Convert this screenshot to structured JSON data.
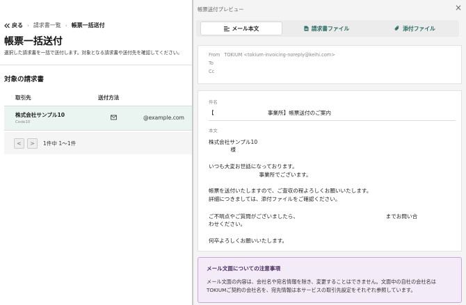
{
  "breadcrumb": {
    "back": "戻る",
    "list": "請求書一覧",
    "current": "帳票一括送付"
  },
  "page": {
    "title": "帳票一括送付",
    "description": "選択した請求書を一括で送付します。対象となる請求書や送付先を確認してください。"
  },
  "section_title": "対象の請求書",
  "table": {
    "headers": [
      "取引先",
      "送付方法"
    ],
    "rows": [
      {
        "name": "株式会社サンプル10",
        "code": "Code10",
        "email": "@example.com"
      }
    ]
  },
  "pager": {
    "prev": "<",
    "next": ">",
    "info": "1件中 1〜1件"
  },
  "drawer": {
    "title": "帳票送付プレビュー",
    "close": "×",
    "tabs": [
      {
        "label": "メール本文",
        "icon": "text-align-icon"
      },
      {
        "label": "請求書ファイル",
        "icon": "file-icon"
      },
      {
        "label": "添付ファイル",
        "icon": "paperclip-icon"
      }
    ],
    "meta": {
      "from_label": "From",
      "from_value": "TOKIUM <tokium-invoicing-noreply@keihi.com>",
      "to_label": "To",
      "cc_label": "Cc"
    },
    "subject_label": "件名",
    "subject": "【                                事業所】帳票送付のご案内",
    "body_label": "本文",
    "body_lines": [
      "株式会社サンプル10",
      "             様",
      "",
      "いつも大変お世話になっております。",
      "                              事業所でございます。",
      "",
      "帳票を送付いたしますので、ご査収の程よろしくお願いいたします。",
      "詳細につきましては、添付ファイルをご確認ください。",
      "",
      "ご不明点やご質問がございましたら、                                                    までお問い合",
      "わせください。",
      "",
      "何卒よろしくお願いいたします。"
    ],
    "notice": {
      "title": "メール文面についての注意事項",
      "line1": "メール文面の内容は、会社名や宛名情報を除き、変更することはできません。文面中の自社の会社名は",
      "line2": "TOKIUMご契約の会社名を、宛先情報は本サービスの取引先設定をそれぞれ参照しています。"
    }
  }
}
